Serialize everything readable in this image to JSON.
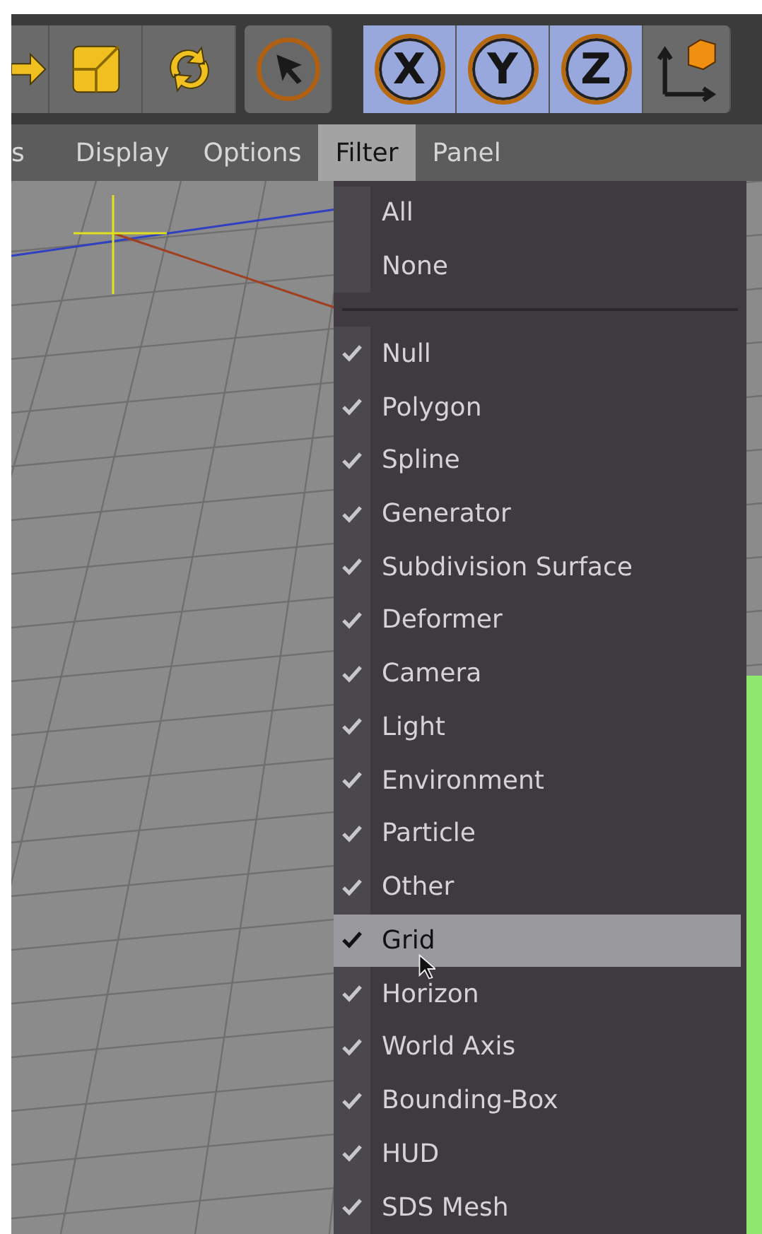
{
  "toolbar": [
    {
      "kind": "move",
      "on": false
    },
    {
      "kind": "scale",
      "on": false
    },
    {
      "kind": "rotate",
      "on": false
    },
    {
      "kind": "select",
      "on": false
    },
    {
      "kind": "axis",
      "label": "X",
      "on": true
    },
    {
      "kind": "axis",
      "label": "Y",
      "on": true
    },
    {
      "kind": "axis",
      "label": "Z",
      "on": true
    },
    {
      "kind": "coords",
      "on": false
    }
  ],
  "menu_bar": [
    {
      "label": "s",
      "selected": false
    },
    {
      "label": "Display",
      "selected": false
    },
    {
      "label": "Options",
      "selected": false
    },
    {
      "label": "Filter",
      "selected": true
    },
    {
      "label": "Panel",
      "selected": false
    }
  ],
  "filter_menu": [
    {
      "kind": "action",
      "label": "All",
      "highlighted": false
    },
    {
      "kind": "action",
      "label": "None",
      "highlighted": false
    },
    {
      "kind": "separator"
    },
    {
      "kind": "toggle",
      "label": "Null",
      "checked": true,
      "highlighted": false
    },
    {
      "kind": "toggle",
      "label": "Polygon",
      "checked": true,
      "highlighted": false
    },
    {
      "kind": "toggle",
      "label": "Spline",
      "checked": true,
      "highlighted": false
    },
    {
      "kind": "toggle",
      "label": "Generator",
      "checked": true,
      "highlighted": false
    },
    {
      "kind": "toggle",
      "label": "Subdivision Surface",
      "checked": true,
      "highlighted": false
    },
    {
      "kind": "toggle",
      "label": "Deformer",
      "checked": true,
      "highlighted": false
    },
    {
      "kind": "toggle",
      "label": "Camera",
      "checked": true,
      "highlighted": false
    },
    {
      "kind": "toggle",
      "label": "Light",
      "checked": true,
      "highlighted": false
    },
    {
      "kind": "toggle",
      "label": "Environment",
      "checked": true,
      "highlighted": false
    },
    {
      "kind": "toggle",
      "label": "Particle",
      "checked": true,
      "highlighted": false
    },
    {
      "kind": "toggle",
      "label": "Other",
      "checked": true,
      "highlighted": false
    },
    {
      "kind": "toggle",
      "label": "Grid",
      "checked": true,
      "highlighted": true
    },
    {
      "kind": "toggle",
      "label": "Horizon",
      "checked": true,
      "highlighted": false
    },
    {
      "kind": "toggle",
      "label": "World Axis",
      "checked": true,
      "highlighted": false
    },
    {
      "kind": "toggle",
      "label": "Bounding-Box",
      "checked": true,
      "highlighted": false
    },
    {
      "kind": "toggle",
      "label": "HUD",
      "checked": true,
      "highlighted": false
    },
    {
      "kind": "toggle",
      "label": "SDS Mesh",
      "checked": true,
      "highlighted": false
    }
  ]
}
